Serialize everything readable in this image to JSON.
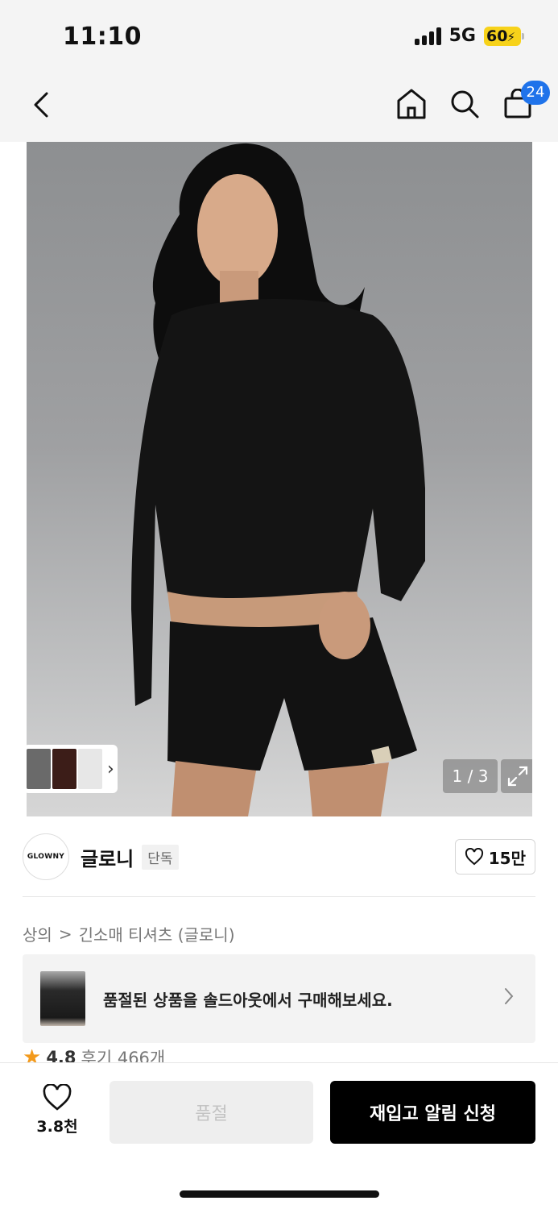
{
  "status_bar": {
    "time": "11:10",
    "network": "5G",
    "battery": "60"
  },
  "header": {
    "cart_count": "24",
    "icons": [
      "back-icon",
      "home-icon",
      "search-icon",
      "shopping-bag-icon"
    ]
  },
  "gallery": {
    "page_indicator": "1 / 3",
    "current_page": 1,
    "total_pages": 3
  },
  "brand": {
    "logo_text": "GLOWNY",
    "name": "글로니",
    "badge": "단독",
    "like_count": "15만"
  },
  "breadcrumb": {
    "category": "상의",
    "separator": ">",
    "subcategory": "긴소매 티셔츠 (글로니)"
  },
  "soldout_banner": {
    "text": "품절된 상품을 솔드아웃에서 구매해보세요."
  },
  "rating": {
    "score": "4.8",
    "reviews": "후기 466개"
  },
  "bottom_bar": {
    "wish_count": "3.8천",
    "soldout_label": "품절",
    "restock_label": "재입고 알림 신청"
  },
  "colors": {
    "accent_blue": "#1f73ea",
    "battery_yellow": "#f7d21a",
    "star_orange": "#f39a1c",
    "primary_button": "#000000"
  }
}
